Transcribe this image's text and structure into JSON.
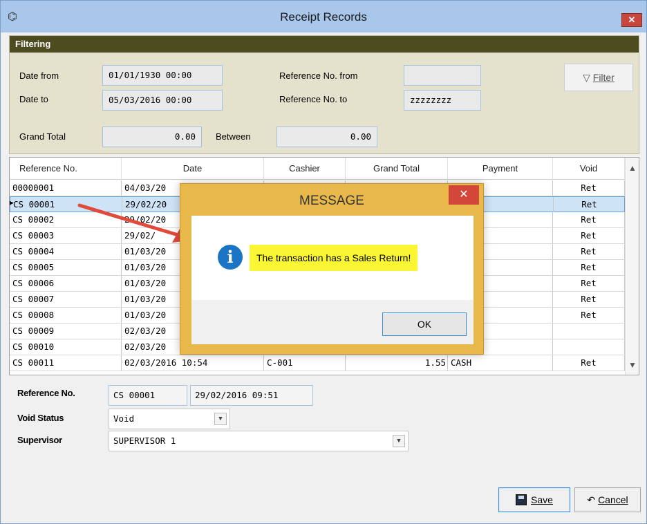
{
  "window": {
    "title": "Receipt Records",
    "close_label": "✕"
  },
  "filtering": {
    "header": "Filtering",
    "date_from_label": "Date from",
    "date_from_value": "01/01/1930 00:00",
    "date_to_label": "Date to",
    "date_to_value": "05/03/2016 00:00",
    "ref_from_label": "Reference No. from",
    "ref_from_value": "",
    "ref_to_label": "Reference No. to",
    "ref_to_value": "zzzzzzzz",
    "grand_total_label": "Grand Total",
    "grand_total_value": "0.00",
    "between_label": "Between",
    "between_value": "0.00",
    "filter_button": "Filter"
  },
  "grid": {
    "columns": [
      "Reference No.",
      "Date",
      "Cashier",
      "Grand Total",
      "Payment",
      "Void"
    ],
    "rows": [
      {
        "ref": "00000001",
        "date": "04/03/20",
        "cashier": "",
        "total": "",
        "payment": "",
        "void": "Ret"
      },
      {
        "ref": "CS 00001",
        "date": "29/02/20",
        "cashier": "",
        "total": "",
        "payment": "",
        "void": "Ret"
      },
      {
        "ref": "CS 00002",
        "date": "29/02/20",
        "cashier": "",
        "total": "",
        "payment": "",
        "void": "Ret"
      },
      {
        "ref": "CS 00003",
        "date": "29/02/",
        "cashier": "",
        "total": "",
        "payment": "",
        "void": "Ret"
      },
      {
        "ref": "CS 00004",
        "date": "01/03/20",
        "cashier": "",
        "total": "",
        "payment": "",
        "void": "Ret"
      },
      {
        "ref": "CS 00005",
        "date": "01/03/20",
        "cashier": "",
        "total": "",
        "payment": "",
        "void": "Ret"
      },
      {
        "ref": "CS 00006",
        "date": "01/03/20",
        "cashier": "",
        "total": "",
        "payment": "",
        "void": "Ret"
      },
      {
        "ref": "CS 00007",
        "date": "01/03/20",
        "cashier": "",
        "total": "",
        "payment": "",
        "void": "Ret"
      },
      {
        "ref": "CS 00008",
        "date": "01/03/20",
        "cashier": "",
        "total": "",
        "payment": "",
        "void": "Ret"
      },
      {
        "ref": "CS 00009",
        "date": "02/03/20",
        "cashier": "",
        "total": "",
        "payment": "",
        "void": ""
      },
      {
        "ref": "CS 00010",
        "date": "02/03/20",
        "cashier": "",
        "total": "",
        "payment": "",
        "void": ""
      },
      {
        "ref": "CS 00011",
        "date": "02/03/2016 10:54",
        "cashier": "C-001",
        "total": "1.55",
        "payment": "CASH",
        "void": "Ret"
      }
    ]
  },
  "detail": {
    "ref_label": "Reference No.",
    "ref_value": "CS 00001",
    "date_value": "29/02/2016 09:51",
    "void_label": "Void Status",
    "void_value": "Void",
    "supervisor_label": "Supervisor",
    "supervisor_value": "SUPERVISOR 1"
  },
  "buttons": {
    "save": "Save",
    "cancel": "Cancel"
  },
  "dialog": {
    "title": "MESSAGE",
    "close_label": "✕",
    "message": "The transaction has a Sales Return!",
    "ok": "OK"
  },
  "colors": {
    "titlebar": "#a9c7ea",
    "filter_header": "#4d4c21",
    "filter_panel": "#e4e2cc",
    "dialog_frame": "#e8b94a",
    "highlight": "#fbf634",
    "annotation_arrow": "#e04a3a"
  },
  "icons": {
    "window": "app-icon",
    "filter": "funnel-icon",
    "info": "info-icon",
    "save": "floppy-disk-icon",
    "cancel": "undo-arrow-icon"
  }
}
